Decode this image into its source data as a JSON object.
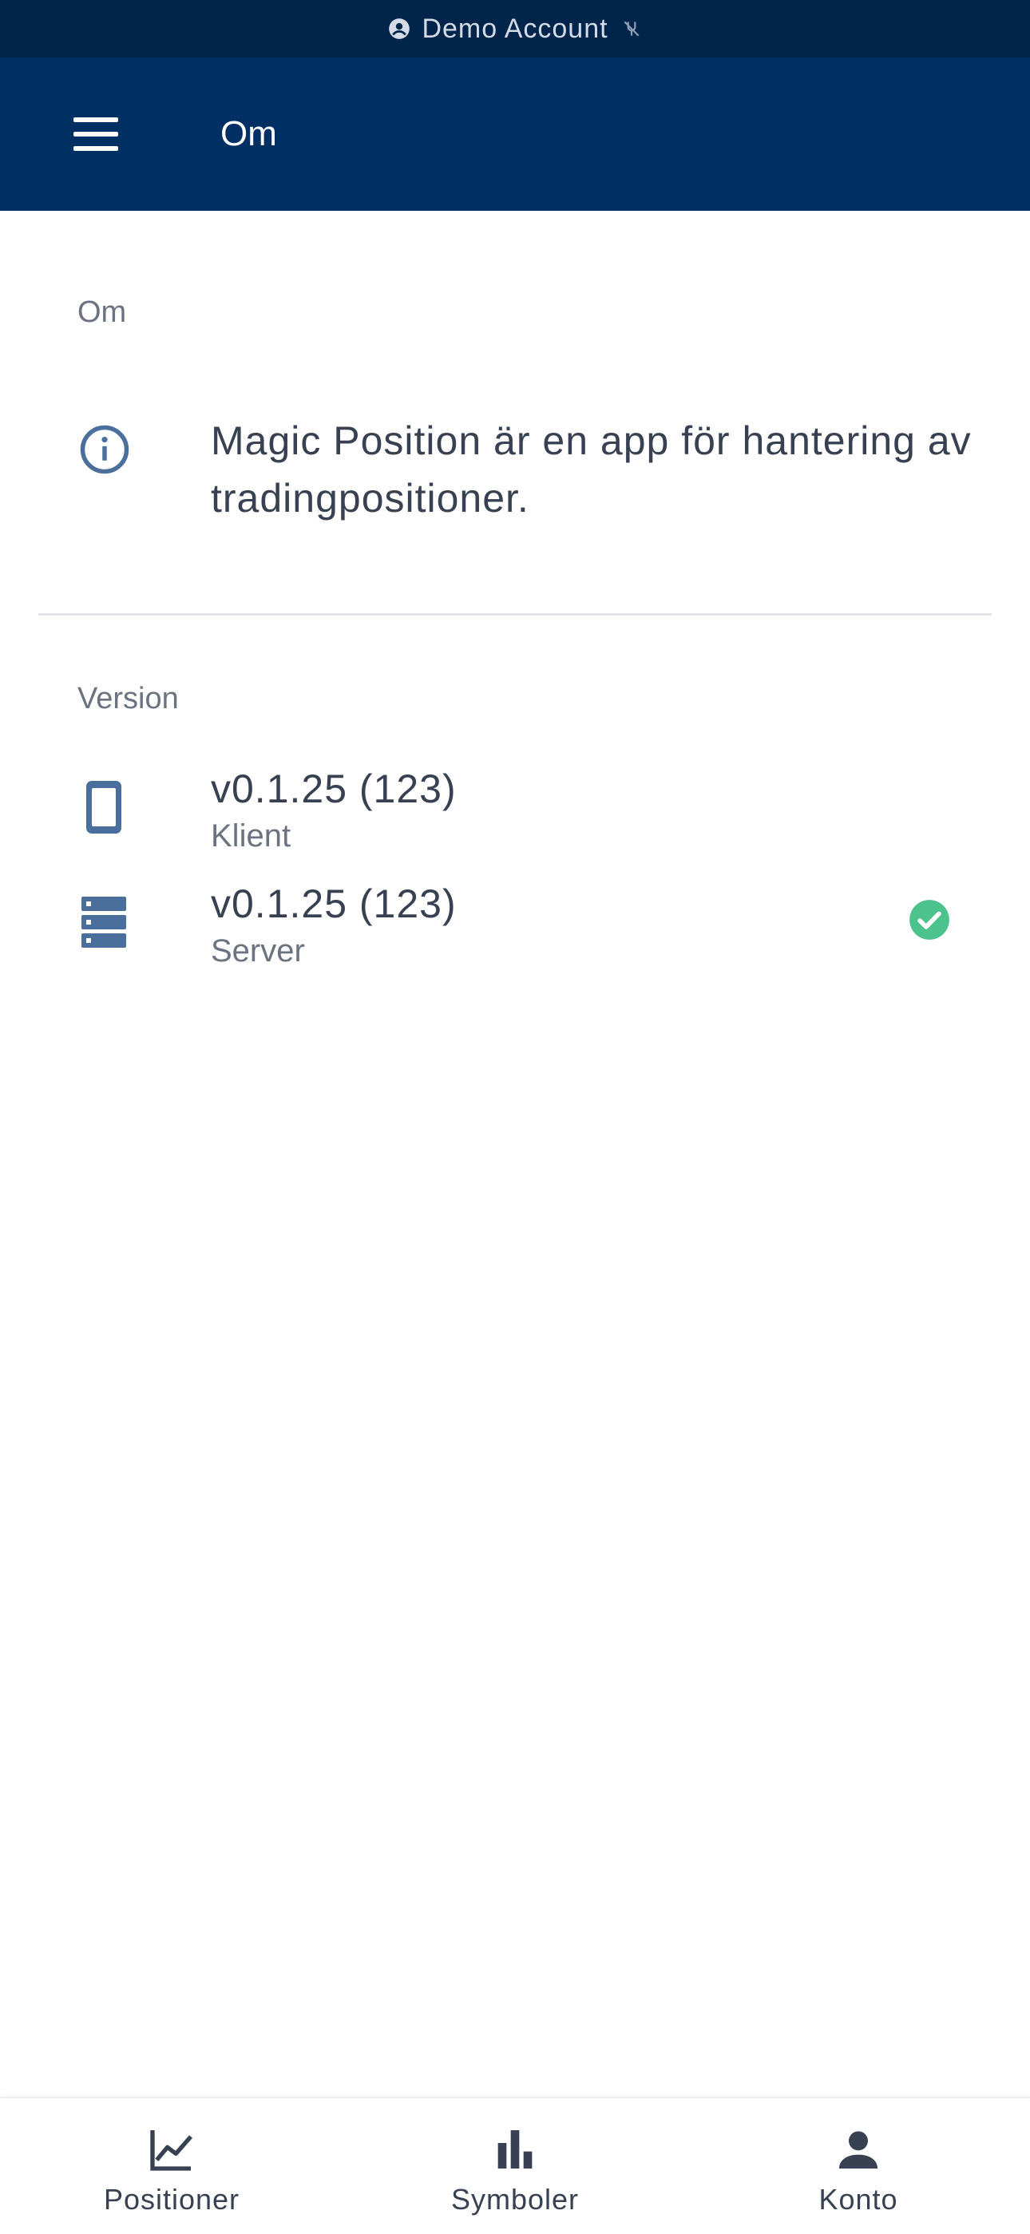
{
  "status_bar": {
    "account_label": "Demo Account"
  },
  "app_bar": {
    "title": "Om"
  },
  "about_section": {
    "label": "Om",
    "description": "Magic Position är en app för hantering av tradingpositioner."
  },
  "version_section": {
    "label": "Version",
    "client": {
      "version": "v0.1.25 (123)",
      "label": "Klient"
    },
    "server": {
      "version": "v0.1.25 (123)",
      "label": "Server"
    }
  },
  "bottom_nav": {
    "items": [
      {
        "label": "Positioner",
        "icon": "line-chart-icon"
      },
      {
        "label": "Symboler",
        "icon": "bar-chart-icon"
      },
      {
        "label": "Konto",
        "icon": "person-icon"
      }
    ]
  },
  "colors": {
    "status_bar_bg": "#00244a",
    "app_bar_bg": "#002f63",
    "icon_blue": "#4a6f9c",
    "success_green": "#4cc28d",
    "text_dark": "#374151",
    "text_muted": "#6b7280"
  }
}
